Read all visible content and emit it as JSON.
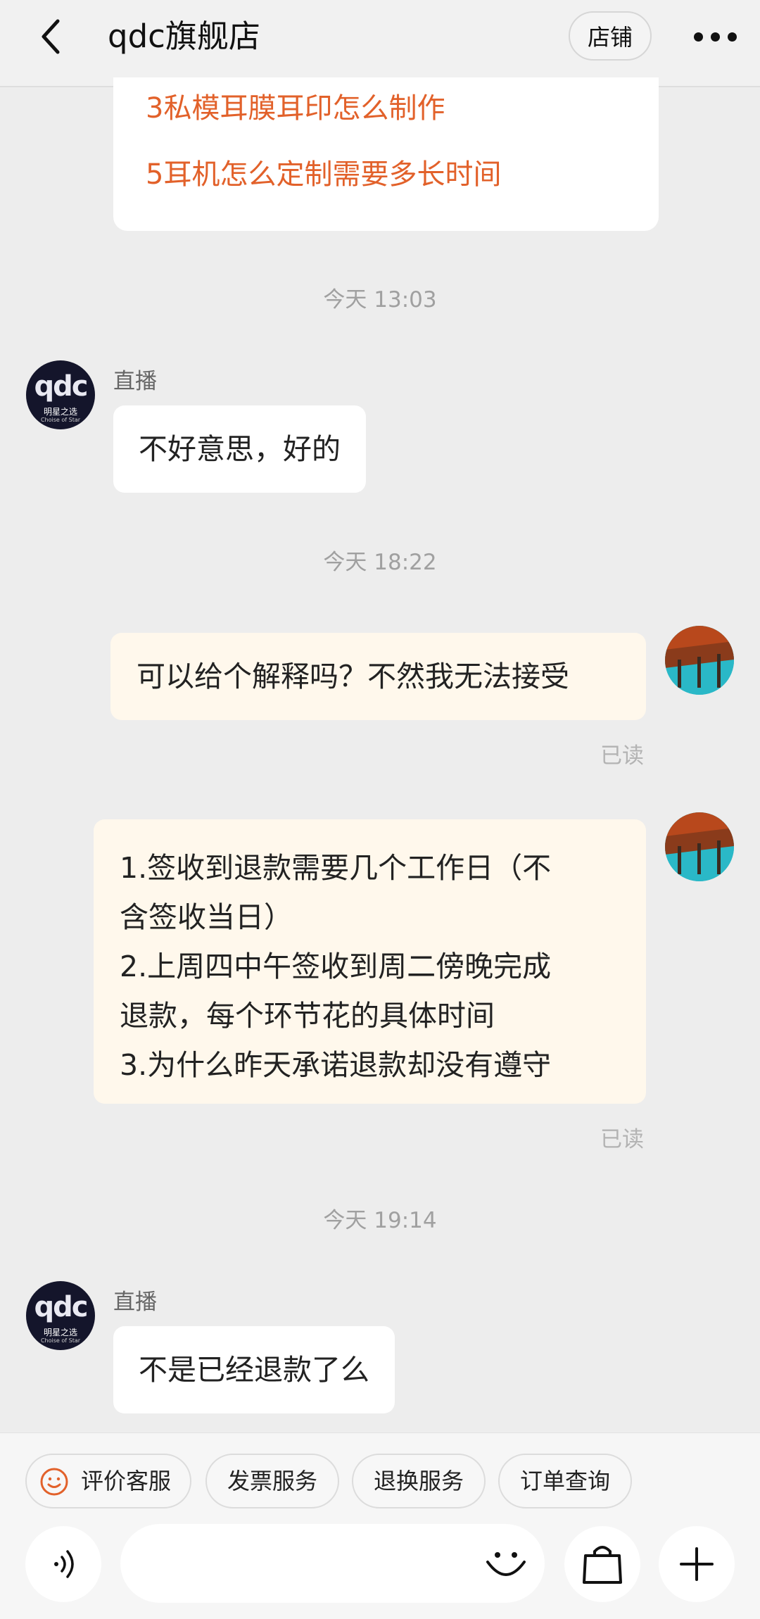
{
  "header": {
    "title": "qdc旗舰店",
    "shop_label": "店铺"
  },
  "faq": {
    "items": [
      "3私模耳膜耳印怎么制作",
      "5耳机怎么定制需要多长时间"
    ]
  },
  "messages": {
    "time1": "今天  13:03",
    "sender1": "直播",
    "msg1": "不好意思，好的",
    "time2": "今天  18:22",
    "msg2": "可以给个解释吗？不然我无法接受",
    "read2": "已读",
    "msg3_lines": [
      "1.签收到退款需要几个工作日（不",
      "含签收当日）",
      "2.上周四中午签收到周二傍晚完成",
      "退款，每个环节花的具体时间",
      "3.为什么昨天承诺退款却没有遵守"
    ],
    "read3": "已读",
    "time3": "今天  19:14",
    "sender4": "直播",
    "msg4": "不是已经退款了么"
  },
  "avatar_text": {
    "logo": "qdc",
    "brand_line": "明星之选",
    "brand_sub": "Choise of Star"
  },
  "quick_actions": [
    "评价客服",
    "发票服务",
    "退换服务",
    "订单查询"
  ],
  "colors": {
    "accent": "#e2612a",
    "outgoing_bubble": "#fff8ec",
    "background": "#ededed"
  },
  "icons": [
    "back-arrow-icon",
    "more-dots-icon",
    "smile-icon",
    "voice-icon",
    "emoji-icon",
    "bag-icon",
    "plus-icon"
  ]
}
